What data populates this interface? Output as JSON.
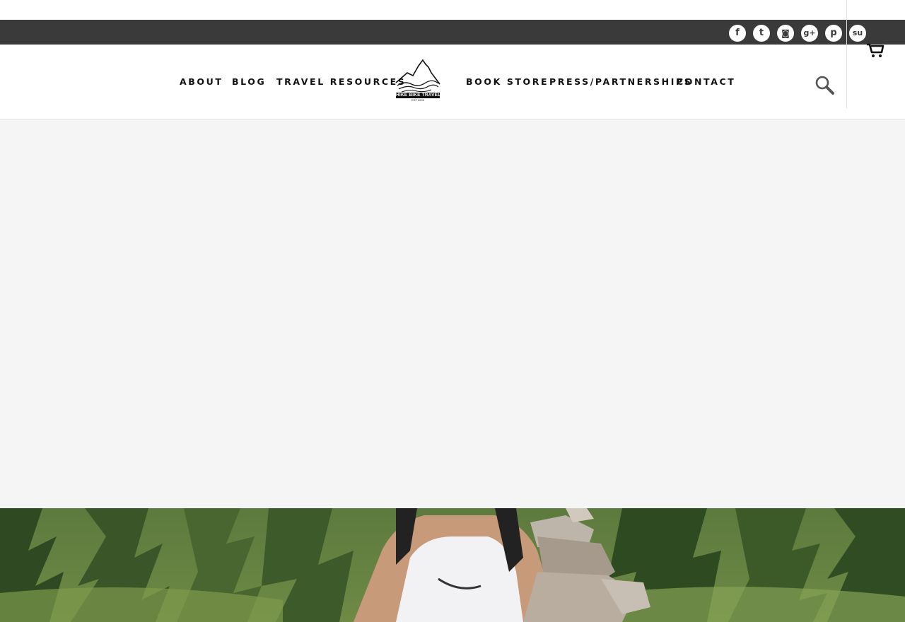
{
  "social": {
    "icons": [
      {
        "name": "facebook",
        "glyph": "f"
      },
      {
        "name": "twitter",
        "glyph": "t"
      },
      {
        "name": "instagram",
        "glyph": "◙"
      },
      {
        "name": "google-plus",
        "glyph": "g+"
      },
      {
        "name": "pinterest",
        "glyph": "p"
      },
      {
        "name": "stumbleupon",
        "glyph": "su"
      }
    ]
  },
  "nav": {
    "left": [
      "ABOUT",
      "BLOG",
      "TRAVEL RESOURCES"
    ],
    "right": [
      "BOOK STORE",
      "PRESS/PARTNERSHIPS",
      "CONTACT"
    ]
  },
  "logo": {
    "text": "HIKE BIKE TRAVEL",
    "est": "EST 2009"
  },
  "colors": {
    "social_bar": "#3a3a3a",
    "content_bg": "#f5f5f5",
    "nav_text": "#111111"
  },
  "icons": {
    "search": "search-icon",
    "cart": "cart-icon"
  }
}
